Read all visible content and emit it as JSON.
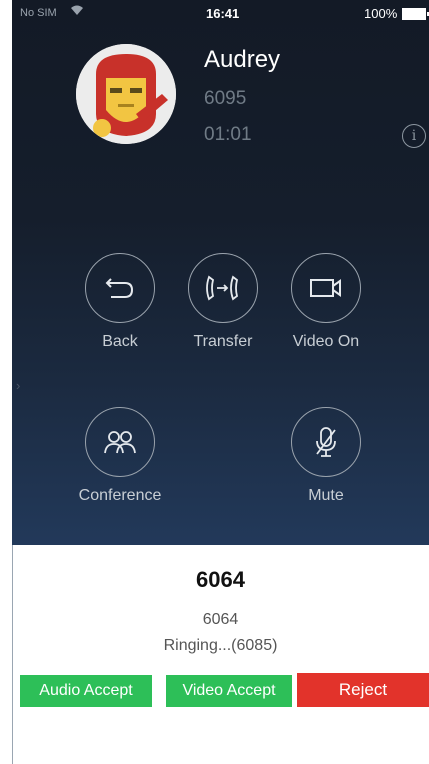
{
  "status_bar": {
    "carrier": "No SIM",
    "wifi_icon": "wifi-icon",
    "time": "16:41",
    "battery": "100%"
  },
  "call": {
    "name": "Audrey",
    "number": "6095",
    "duration": "01:01",
    "info_icon": "i"
  },
  "actions": {
    "back": "Back",
    "transfer": "Transfer",
    "video_on": "Video On",
    "conference": "Conference",
    "mute": "Mute"
  },
  "incoming": {
    "title": "6064",
    "subtitle": "6064",
    "status": "Ringing...(6085)",
    "audio_accept": "Audio Accept",
    "video_accept": "Video Accept",
    "reject": "Reject"
  },
  "colors": {
    "accept": "#2dbf58",
    "reject": "#e2332b",
    "background": "#151e2c"
  }
}
